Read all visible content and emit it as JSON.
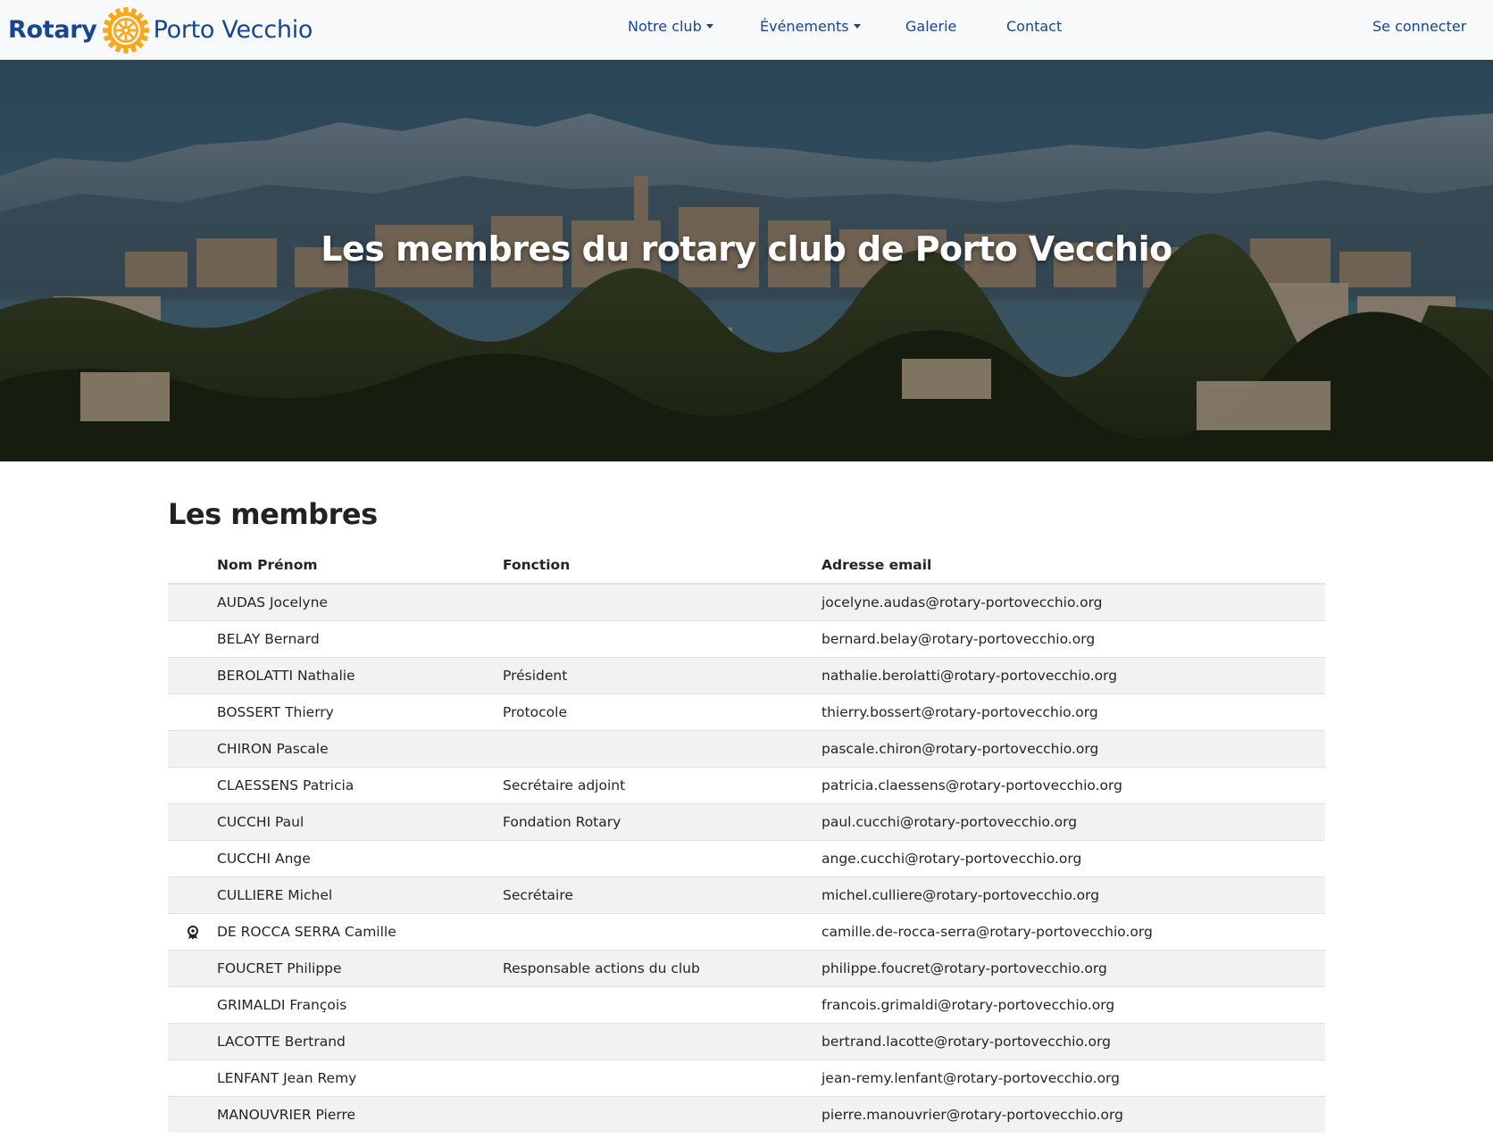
{
  "header": {
    "brand_rotary": "Rotary",
    "brand_club": "Porto Vecchio",
    "brand_logo_icon": "rotary-wheel-icon",
    "nav": [
      {
        "label": "Notre club",
        "dropdown": true
      },
      {
        "label": "Événements",
        "dropdown": true
      },
      {
        "label": "Galerie",
        "dropdown": false
      },
      {
        "label": "Contact",
        "dropdown": false
      }
    ],
    "login_label": "Se connecter"
  },
  "hero": {
    "title": "Les membres du rotary club de Porto Vecchio"
  },
  "members": {
    "title": "Les membres",
    "columns": [
      "Nom Prénom",
      "Fonction",
      "Adresse email"
    ],
    "rows": [
      {
        "icon": "",
        "name": "AUDAS Jocelyne",
        "role": "",
        "email": "jocelyne.audas@rotary-portovecchio.org"
      },
      {
        "icon": "",
        "name": "BELAY Bernard",
        "role": "",
        "email": "bernard.belay@rotary-portovecchio.org"
      },
      {
        "icon": "",
        "name": "BEROLATTI Nathalie",
        "role": "Président",
        "email": "nathalie.berolatti@rotary-portovecchio.org"
      },
      {
        "icon": "",
        "name": "BOSSERT Thierry",
        "role": "Protocole",
        "email": "thierry.bossert@rotary-portovecchio.org"
      },
      {
        "icon": "",
        "name": "CHIRON Pascale",
        "role": "",
        "email": "pascale.chiron@rotary-portovecchio.org"
      },
      {
        "icon": "",
        "name": "CLAESSENS Patricia",
        "role": "Secrétaire adjoint",
        "email": "patricia.claessens@rotary-portovecchio.org"
      },
      {
        "icon": "",
        "name": "CUCCHI Paul",
        "role": "Fondation Rotary",
        "email": "paul.cucchi@rotary-portovecchio.org"
      },
      {
        "icon": "",
        "name": "CUCCHI Ange",
        "role": "",
        "email": "ange.cucchi@rotary-portovecchio.org"
      },
      {
        "icon": "",
        "name": "CULLIERE Michel",
        "role": "Secrétaire",
        "email": "michel.culliere@rotary-portovecchio.org"
      },
      {
        "icon": "award-ribbon-icon",
        "name": "DE ROCCA SERRA Camille",
        "role": "",
        "email": "camille.de-rocca-serra@rotary-portovecchio.org"
      },
      {
        "icon": "",
        "name": "FOUCRET Philippe",
        "role": "Responsable actions du club",
        "email": "philippe.foucret@rotary-portovecchio.org"
      },
      {
        "icon": "",
        "name": "GRIMALDI François",
        "role": "",
        "email": "francois.grimaldi@rotary-portovecchio.org"
      },
      {
        "icon": "",
        "name": "LACOTTE Bertrand",
        "role": "",
        "email": "bertrand.lacotte@rotary-portovecchio.org"
      },
      {
        "icon": "",
        "name": "LENFANT Jean Remy",
        "role": "",
        "email": "jean-remy.lenfant@rotary-portovecchio.org"
      },
      {
        "icon": "",
        "name": "MANOUVRIER Pierre",
        "role": "",
        "email": "pierre.manouvrier@rotary-portovecchio.org"
      }
    ]
  },
  "colors": {
    "brand_blue": "#17458f",
    "brand_gold": "#f7a81b",
    "navbar_bg": "#f8f9fa",
    "stripe_bg": "#f2f2f2"
  }
}
